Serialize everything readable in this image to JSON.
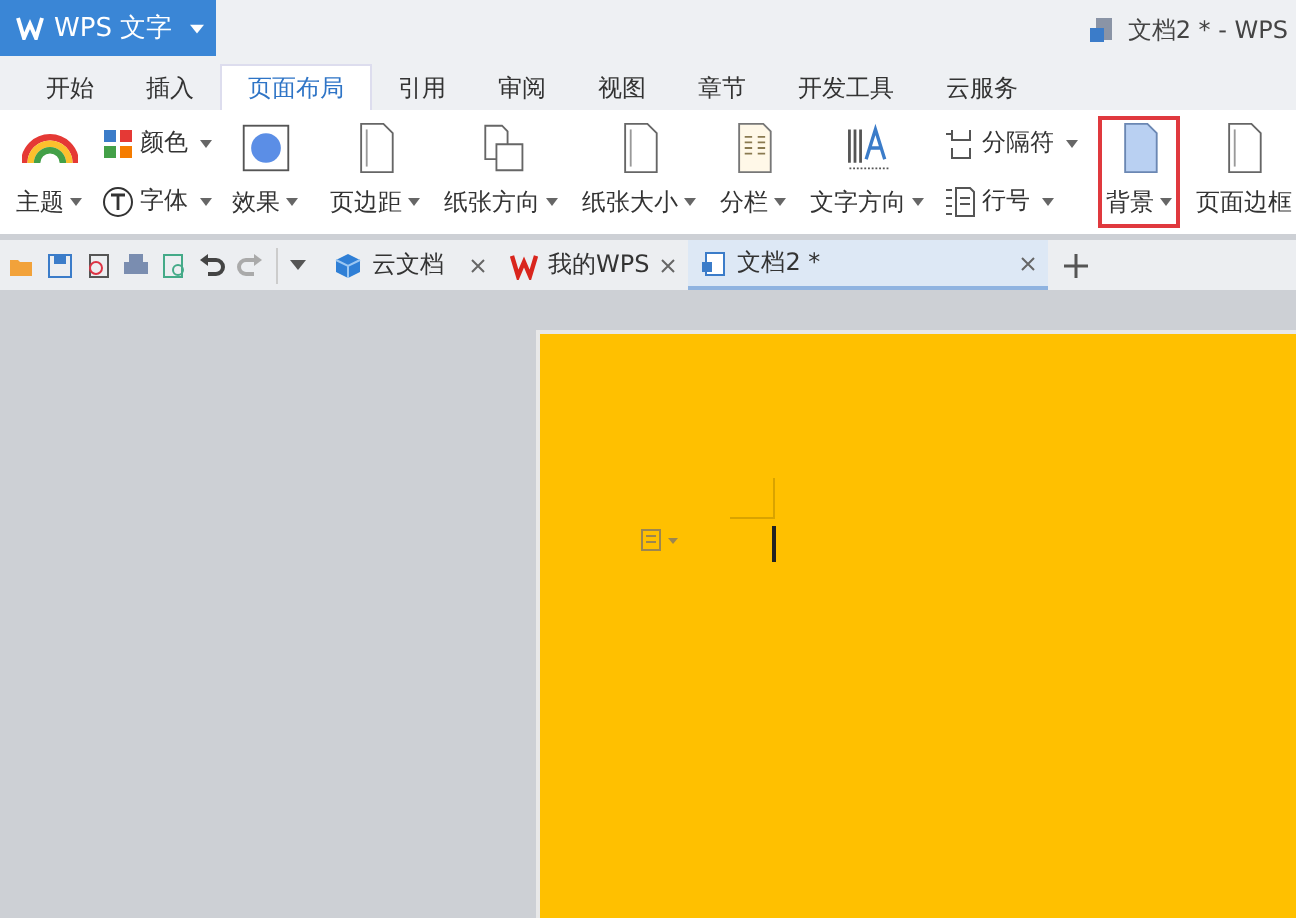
{
  "app_button": {
    "label": "WPS 文字"
  },
  "window_title": "文档2 * - WPS",
  "menu_tabs": [
    {
      "label": "开始",
      "selected": false
    },
    {
      "label": "插入",
      "selected": false
    },
    {
      "label": "页面布局",
      "selected": true
    },
    {
      "label": "引用",
      "selected": false
    },
    {
      "label": "审阅",
      "selected": false
    },
    {
      "label": "视图",
      "selected": false
    },
    {
      "label": "章节",
      "selected": false
    },
    {
      "label": "开发工具",
      "selected": false
    },
    {
      "label": "云服务",
      "selected": false
    }
  ],
  "ribbon": {
    "groups": [
      {
        "columns": [
          {
            "items": [
              {
                "kind": "large",
                "label": "主题",
                "dropdown": true,
                "highlighted": false
              }
            ]
          },
          {
            "items": [
              {
                "kind": "small",
                "label": "颜色",
                "dropdown": true,
                "highlighted": false
              },
              {
                "kind": "small",
                "label": "字体",
                "dropdown": true,
                "highlighted": false
              }
            ]
          },
          {
            "items": [
              {
                "kind": "large",
                "label": "效果",
                "dropdown": true,
                "highlighted": false
              }
            ]
          }
        ]
      },
      {
        "columns": [
          {
            "items": [
              {
                "kind": "large",
                "label": "页边距",
                "dropdown": true,
                "highlighted": false
              }
            ]
          },
          {
            "items": [
              {
                "kind": "large",
                "label": "纸张方向",
                "dropdown": true,
                "highlighted": false
              }
            ]
          },
          {
            "items": [
              {
                "kind": "large",
                "label": "纸张大小",
                "dropdown": true,
                "highlighted": false
              }
            ]
          },
          {
            "items": [
              {
                "kind": "large",
                "label": "分栏",
                "dropdown": true,
                "highlighted": false
              }
            ]
          },
          {
            "items": [
              {
                "kind": "large",
                "label": "文字方向",
                "dropdown": true,
                "highlighted": false
              }
            ]
          },
          {
            "items": [
              {
                "kind": "small",
                "label": "分隔符",
                "dropdown": true,
                "highlighted": false
              },
              {
                "kind": "small",
                "label": "行号",
                "dropdown": true,
                "highlighted": false
              }
            ]
          }
        ]
      },
      {
        "columns": [
          {
            "items": [
              {
                "kind": "large",
                "label": "背景",
                "dropdown": true,
                "highlighted": true
              }
            ]
          },
          {
            "items": [
              {
                "kind": "large",
                "label": "页面边框",
                "dropdown": false,
                "highlighted": false
              }
            ]
          }
        ]
      }
    ]
  },
  "doc_tabs": [
    {
      "label": "云文档",
      "selected": false
    },
    {
      "label": "我的WPS",
      "selected": false
    },
    {
      "label": "文档2 *",
      "selected": true
    }
  ]
}
